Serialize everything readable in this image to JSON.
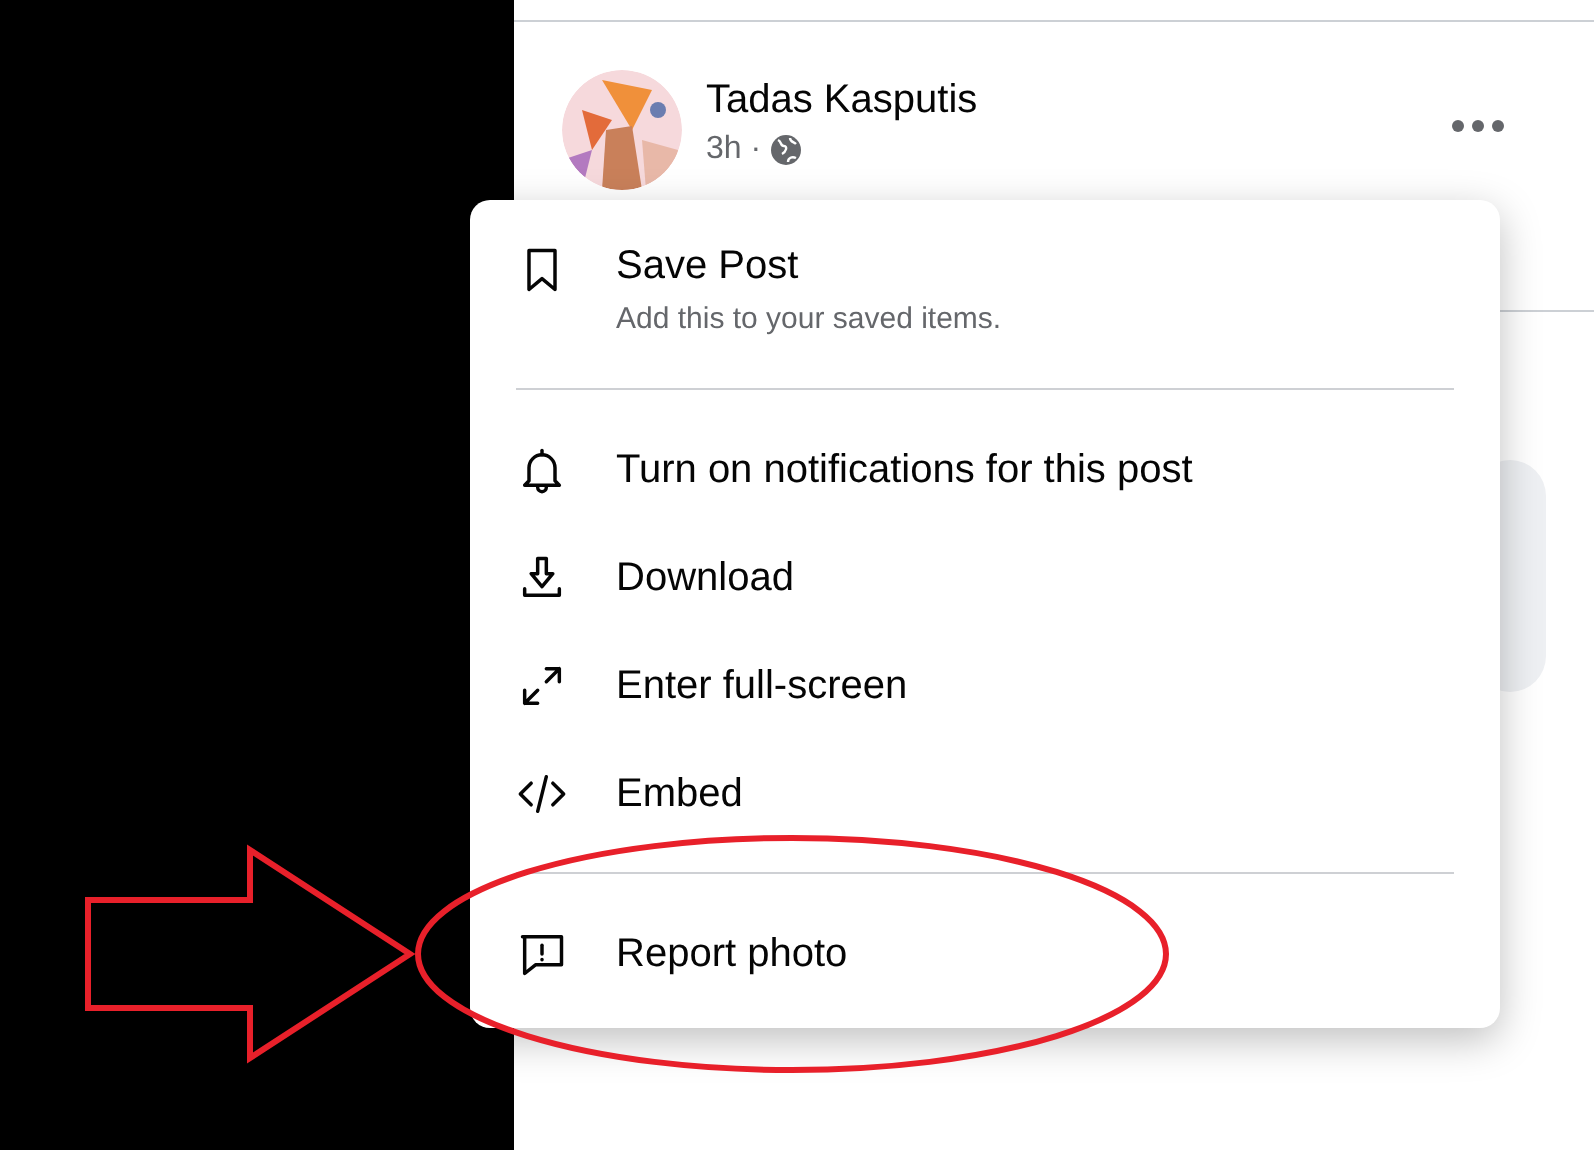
{
  "post": {
    "author": "Tadas Kasputis",
    "time": "3h ·"
  },
  "menu": {
    "groups": [
      [
        {
          "kind": "bookmark",
          "label": "Save Post",
          "description": "Add this to your saved items."
        }
      ],
      [
        {
          "kind": "bell",
          "label": "Turn on notifications for this post"
        },
        {
          "kind": "download",
          "label": "Download"
        },
        {
          "kind": "expand",
          "label": "Enter full-screen"
        },
        {
          "kind": "code",
          "label": "Embed"
        }
      ],
      [
        {
          "kind": "report",
          "label": "Report photo"
        }
      ]
    ]
  }
}
